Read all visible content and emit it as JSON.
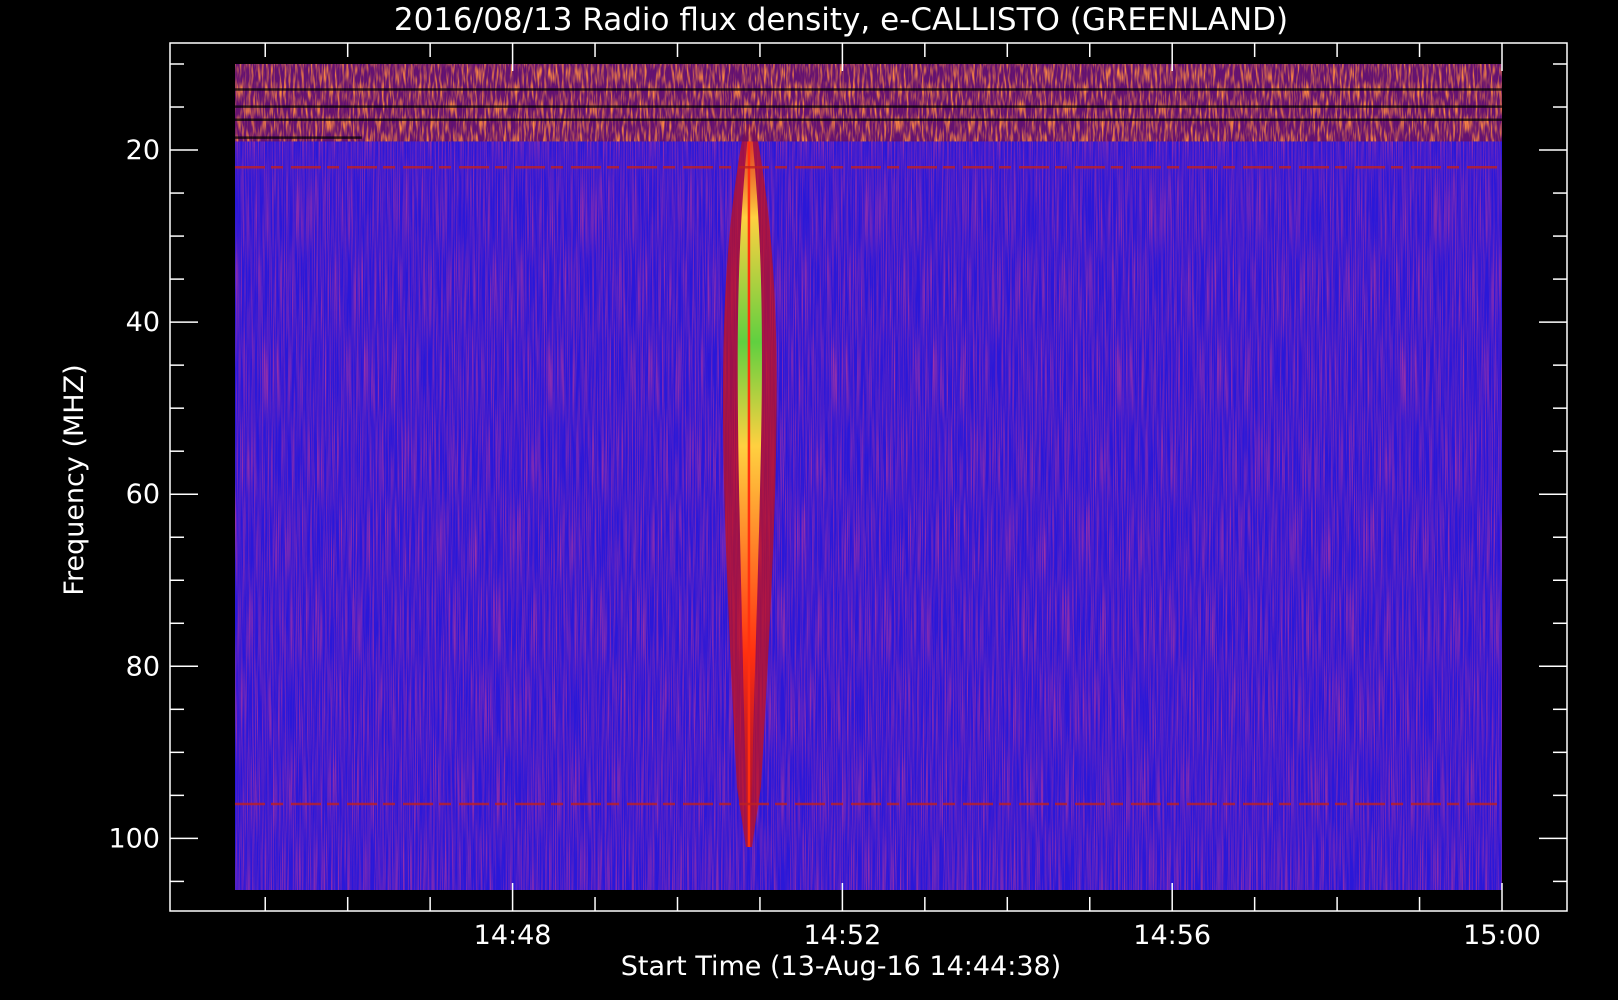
{
  "chart_data": {
    "type": "heatmap",
    "title": "2016/08/13  Radio flux density, e-CALLISTO (GREENLAND)",
    "xlabel": "Start Time (13-Aug-16 14:44:38)",
    "ylabel": "Frequency (MHZ)",
    "x_axis": {
      "unit": "time",
      "range": [
        "14:44:38",
        "15:00:00"
      ],
      "major_ticks": [
        {
          "value": "14:48",
          "label": "14:48"
        },
        {
          "value": "14:52",
          "label": "14:52"
        },
        {
          "value": "14:56",
          "label": "14:56"
        },
        {
          "value": "15:00",
          "label": "15:00"
        }
      ],
      "minor_tick_interval_min": 1
    },
    "y_axis": {
      "unit": "MHz",
      "range": [
        106,
        10
      ],
      "inverted": true,
      "major_ticks": [
        20,
        40,
        60,
        80,
        100
      ],
      "minor_tick_interval": 5
    },
    "colormap": "blue-red-yellow-green",
    "colors": {
      "background_frame": "#000000",
      "low_flux": "#2a18d8",
      "medium_flux": "#cc1010",
      "high_flux": "#ffd020",
      "peak_flux": "#3ccc3c",
      "axis": "#ffffff"
    },
    "features": [
      {
        "kind": "burst",
        "description": "Type III radio burst",
        "time": "14:50:52",
        "freq_min": 17,
        "freq_max": 101,
        "peak_freq": 40
      },
      {
        "kind": "interference_band",
        "time_start": "14:44:38",
        "time_end": "15:00:00",
        "freq_min": 10,
        "freq_max": 19
      },
      {
        "kind": "interference_line",
        "time_start": "14:44:38",
        "time_end": "15:00:00",
        "freq": 22
      },
      {
        "kind": "interference_line",
        "time_start": "14:44:38",
        "time_end": "15:00:00",
        "freq": 96
      }
    ]
  }
}
